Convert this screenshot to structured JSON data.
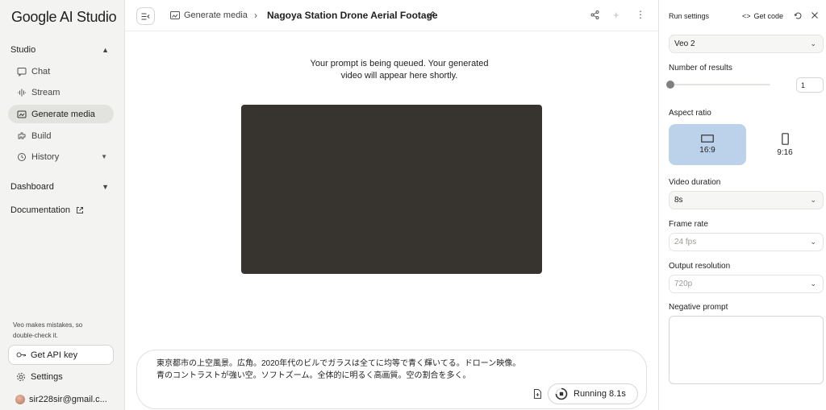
{
  "sidebar": {
    "logo": "Google AI Studio",
    "studio_label": "Studio",
    "items": [
      {
        "label": "Chat",
        "icon": "chat-icon"
      },
      {
        "label": "Stream",
        "icon": "stream-icon"
      },
      {
        "label": "Generate media",
        "icon": "generate-media-icon"
      },
      {
        "label": "Build",
        "icon": "build-icon"
      },
      {
        "label": "History",
        "icon": "history-icon"
      }
    ],
    "dashboard_label": "Dashboard",
    "documentation_label": "Documentation",
    "note": "Veo makes mistakes, so double-check it.",
    "api_key_label": "Get API key",
    "settings_label": "Settings",
    "account_email": "sir228sir@gmail.c..."
  },
  "header": {
    "breadcrumb": "Generate media",
    "title": "Nagoya Station Drone Aerial Footage"
  },
  "main": {
    "queued_message": "Your prompt is being queued. Your generated video will appear here shortly.",
    "prompt_line1": "東京都市の上空風景。広角。2020年代のビルでガラスは全てに均等で青く輝いてる。ドローン映像。",
    "prompt_line2": "青のコントラストが強い空。ソフトズーム。全体的に明るく高画質。空の割合を多く。",
    "run_label": "Running 8.1s"
  },
  "run_settings": {
    "title": "Run settings",
    "get_code_label": "Get code",
    "model": "Veo 2",
    "num_results_label": "Number of results",
    "num_results_value": "1",
    "aspect_ratio_label": "Aspect ratio",
    "aspect_options": [
      {
        "label": "16:9",
        "selected": true
      },
      {
        "label": "9:16",
        "selected": false
      }
    ],
    "video_duration_label": "Video duration",
    "video_duration_value": "8s",
    "frame_rate_label": "Frame rate",
    "frame_rate_value": "24 fps",
    "output_resolution_label": "Output resolution",
    "output_resolution_value": "720p",
    "negative_prompt_label": "Negative prompt"
  },
  "colors": {
    "sidebar_bg": "#f3f3f1",
    "active_item_bg": "#e2e2df",
    "video_placeholder": "#373430",
    "selected_tile": "#bcd2ea"
  }
}
